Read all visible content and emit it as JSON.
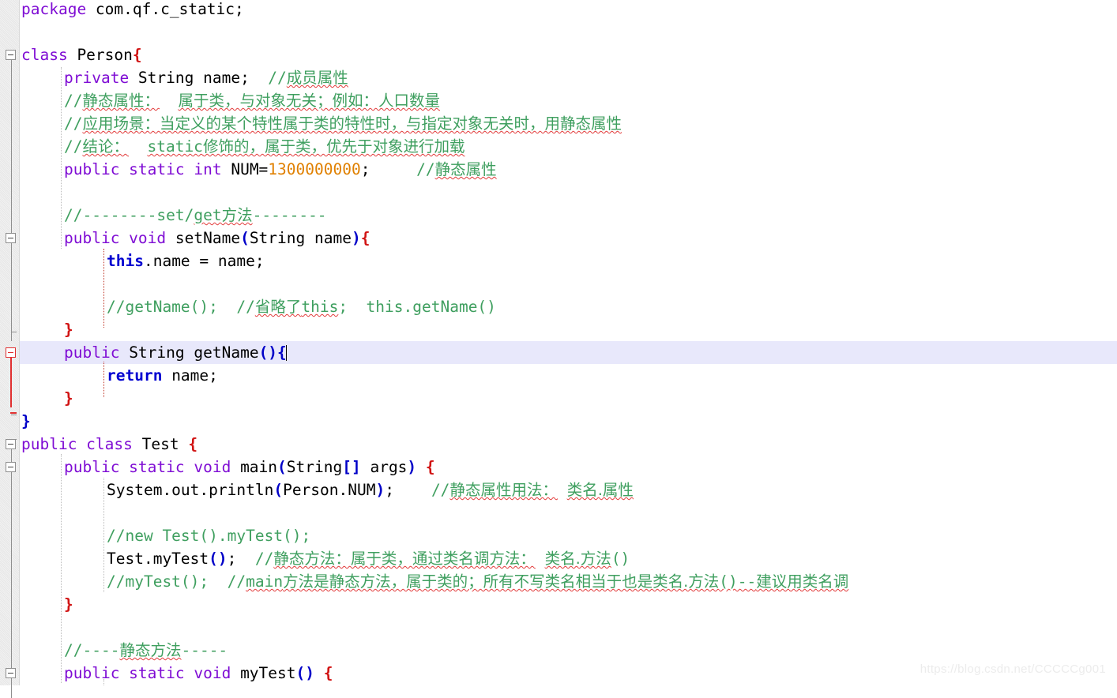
{
  "editor": {
    "language": "java",
    "background_color": "#ffffff",
    "current_line_highlight_color": "#e8e8fb",
    "gutter_color": "#eeeeee",
    "colors": {
      "keyword": "#7f0cd4",
      "keyword_bold": "#0000d0",
      "comment": "#3f9f5f",
      "number": "#e08000",
      "bracket": "#0000c8",
      "brace_red": "#d11414",
      "spell_squiggle": "#e23b3b",
      "fold_marker": "#8f8f8f",
      "fold_marker_active": "#e03030"
    },
    "caret_line_index": 14
  },
  "watermark": {
    "text": "https://blog.csdn.net/CCCCCg001"
  },
  "code_lines": [
    {
      "index": 0,
      "indent": 0,
      "segments": [
        {
          "cls": "kw",
          "text": "package"
        },
        {
          "cls": "plain",
          "text": " com.qf.c_static;"
        }
      ]
    },
    {
      "index": 1,
      "indent": 0,
      "segments": []
    },
    {
      "index": 2,
      "indent": 0,
      "segments": [
        {
          "cls": "kw",
          "text": "class"
        },
        {
          "cls": "plain",
          "text": " Person"
        },
        {
          "cls": "brace-red",
          "text": "{"
        }
      ]
    },
    {
      "index": 3,
      "indent": 1,
      "segments": [
        {
          "cls": "kw",
          "text": "private"
        },
        {
          "cls": "plain",
          "text": " String name;  "
        },
        {
          "cls": "cmt",
          "text": "//"
        },
        {
          "cls": "cmt sq cjk",
          "text": "成员属性"
        }
      ]
    },
    {
      "index": 4,
      "indent": 1,
      "segments": [
        {
          "cls": "cmt",
          "text": "//"
        },
        {
          "cls": "cmt sq cjk",
          "text": "静态属性："
        },
        {
          "cls": "cmt",
          "text": "  "
        },
        {
          "cls": "cmt sq cjk",
          "text": "属于类，与对象无关；例如：人口数量"
        }
      ]
    },
    {
      "index": 5,
      "indent": 1,
      "segments": [
        {
          "cls": "cmt",
          "text": "//"
        },
        {
          "cls": "cmt sq cjk",
          "text": "应用场景：当定义的某个特性属于类的特性时，与指定对象无关时，用静态属性"
        }
      ]
    },
    {
      "index": 6,
      "indent": 1,
      "segments": [
        {
          "cls": "cmt",
          "text": "//"
        },
        {
          "cls": "cmt sq cjk",
          "text": "结论："
        },
        {
          "cls": "cmt",
          "text": "  "
        },
        {
          "cls": "cmt sq",
          "text": "static"
        },
        {
          "cls": "cmt sq cjk",
          "text": "修饰的，属于类，优先于对象进行加载"
        }
      ]
    },
    {
      "index": 7,
      "indent": 1,
      "segments": [
        {
          "cls": "kw",
          "text": "public static int"
        },
        {
          "cls": "plain",
          "text": " NUM="
        },
        {
          "cls": "num",
          "text": "1300000000"
        },
        {
          "cls": "plain",
          "text": ";    "
        },
        {
          "cls": "cmt",
          "text": " //"
        },
        {
          "cls": "cmt sq cjk",
          "text": "静态属性"
        }
      ]
    },
    {
      "index": 8,
      "indent": 1,
      "segments": []
    },
    {
      "index": 9,
      "indent": 1,
      "segments": [
        {
          "cls": "cmt",
          "text": "//--------set/"
        },
        {
          "cls": "cmt sq",
          "text": "get"
        },
        {
          "cls": "cmt sq cjk",
          "text": "方法"
        },
        {
          "cls": "cmt",
          "text": "--------"
        }
      ]
    },
    {
      "index": 10,
      "indent": 1,
      "segments": [
        {
          "cls": "kw",
          "text": "public void"
        },
        {
          "cls": "plain",
          "text": " setName"
        },
        {
          "cls": "bracket",
          "text": "("
        },
        {
          "cls": "plain",
          "text": "String name"
        },
        {
          "cls": "bracket",
          "text": ")"
        },
        {
          "cls": "brace-red",
          "text": "{"
        }
      ]
    },
    {
      "index": 11,
      "indent": 2,
      "segments": [
        {
          "cls": "kw2",
          "text": "this"
        },
        {
          "cls": "plain",
          "text": ".name "
        },
        {
          "cls": "plain",
          "text": "= name;"
        }
      ]
    },
    {
      "index": 12,
      "indent": 2,
      "segments": []
    },
    {
      "index": 13,
      "indent": 2,
      "segments": [
        {
          "cls": "cmt",
          "text": "//getName();  //"
        },
        {
          "cls": "cmt sq cjk",
          "text": "省略了"
        },
        {
          "cls": "cmt sq",
          "text": "this"
        },
        {
          "cls": "cmt",
          "text": ";  this.getName()"
        }
      ]
    },
    {
      "index": 14,
      "indent": 1,
      "segments": [
        {
          "cls": "brace-red",
          "text": "}"
        }
      ]
    },
    {
      "index": 15,
      "indent": 1,
      "segments": [
        {
          "cls": "kw",
          "text": "public"
        },
        {
          "cls": "plain",
          "text": " String getName"
        },
        {
          "cls": "bracket",
          "text": "()"
        },
        {
          "cls": "brace-blue",
          "text": "{"
        }
      ],
      "current": true,
      "caret_after": true
    },
    {
      "index": 16,
      "indent": 2,
      "segments": [
        {
          "cls": "kw2",
          "text": "return"
        },
        {
          "cls": "plain",
          "text": " name;"
        }
      ]
    },
    {
      "index": 17,
      "indent": 1,
      "segments": [
        {
          "cls": "brace-red",
          "text": "}"
        }
      ]
    },
    {
      "index": 18,
      "indent": 0,
      "segments": [
        {
          "cls": "brace-blue",
          "text": "}"
        }
      ]
    },
    {
      "index": 19,
      "indent": 0,
      "segments": [
        {
          "cls": "kw",
          "text": "public class"
        },
        {
          "cls": "plain",
          "text": " Test "
        },
        {
          "cls": "brace-red",
          "text": "{"
        }
      ]
    },
    {
      "index": 20,
      "indent": 1,
      "segments": [
        {
          "cls": "kw",
          "text": "public static void"
        },
        {
          "cls": "plain",
          "text": " main"
        },
        {
          "cls": "bracket",
          "text": "("
        },
        {
          "cls": "plain",
          "text": "String"
        },
        {
          "cls": "bracket",
          "text": "[]"
        },
        {
          "cls": "plain",
          "text": " args"
        },
        {
          "cls": "bracket",
          "text": ")"
        },
        {
          "cls": "plain",
          "text": " "
        },
        {
          "cls": "brace-red",
          "text": "{"
        }
      ]
    },
    {
      "index": 21,
      "indent": 2,
      "segments": [
        {
          "cls": "plain",
          "text": "System.out.println"
        },
        {
          "cls": "bracket",
          "text": "("
        },
        {
          "cls": "plain",
          "text": "Person.NUM"
        },
        {
          "cls": "bracket",
          "text": ")"
        },
        {
          "cls": "plain",
          "text": ";   "
        },
        {
          "cls": "cmt",
          "text": " //"
        },
        {
          "cls": "cmt sq cjk",
          "text": "静态属性用法："
        },
        {
          "cls": "cmt",
          "text": " "
        },
        {
          "cls": "cmt sq cjk",
          "text": "类名.属性"
        }
      ]
    },
    {
      "index": 22,
      "indent": 2,
      "segments": []
    },
    {
      "index": 23,
      "indent": 2,
      "segments": [
        {
          "cls": "cmt",
          "text": "//new Test().myTest();"
        }
      ]
    },
    {
      "index": 24,
      "indent": 2,
      "segments": [
        {
          "cls": "plain",
          "text": "Test.myTest"
        },
        {
          "cls": "bracket",
          "text": "()"
        },
        {
          "cls": "plain",
          "text": ";  "
        },
        {
          "cls": "cmt",
          "text": "//"
        },
        {
          "cls": "cmt sq cjk",
          "text": "静态方法：属于类，通过类名调方法："
        },
        {
          "cls": "cmt",
          "text": " "
        },
        {
          "cls": "cmt sq cjk",
          "text": "类名.方法"
        },
        {
          "cls": "cmt",
          "text": "()"
        }
      ]
    },
    {
      "index": 25,
      "indent": 2,
      "segments": [
        {
          "cls": "cmt",
          "text": "//myTest();  //"
        },
        {
          "cls": "cmt sq",
          "text": "main"
        },
        {
          "cls": "cmt sq cjk",
          "text": "方法是静态方法，属于类的；所有不写类名相当于也是类名.方法"
        },
        {
          "cls": "cmt sq",
          "text": "()--"
        },
        {
          "cls": "cmt sq cjk",
          "text": "建议用类名调"
        }
      ]
    },
    {
      "index": 26,
      "indent": 1,
      "segments": [
        {
          "cls": "brace-red",
          "text": "}"
        }
      ]
    },
    {
      "index": 27,
      "indent": 1,
      "segments": []
    },
    {
      "index": 28,
      "indent": 1,
      "segments": [
        {
          "cls": "cmt",
          "text": "//----"
        },
        {
          "cls": "cmt sq cjk",
          "text": "静态方法"
        },
        {
          "cls": "cmt",
          "text": "-----"
        }
      ]
    },
    {
      "index": 29,
      "indent": 1,
      "segments": [
        {
          "cls": "kw",
          "text": "public static void"
        },
        {
          "cls": "plain",
          "text": " myTest"
        },
        {
          "cls": "bracket",
          "text": "()"
        },
        {
          "cls": "plain",
          "text": " "
        },
        {
          "cls": "brace-red",
          "text": "{"
        }
      ]
    }
  ],
  "fold_markers": [
    {
      "name": "fold-class-person",
      "line": 2,
      "state": "expanded",
      "active": false
    },
    {
      "name": "fold-method-setname",
      "line": 10,
      "state": "expanded",
      "active": false
    },
    {
      "name": "fold-method-getname",
      "line": 15,
      "state": "expanded",
      "active": true
    },
    {
      "name": "fold-class-test",
      "line": 19,
      "state": "expanded",
      "active": false
    },
    {
      "name": "fold-method-main",
      "line": 20,
      "state": "expanded",
      "active": false
    },
    {
      "name": "fold-method-mytest",
      "line": 29,
      "state": "expanded",
      "active": false
    }
  ]
}
